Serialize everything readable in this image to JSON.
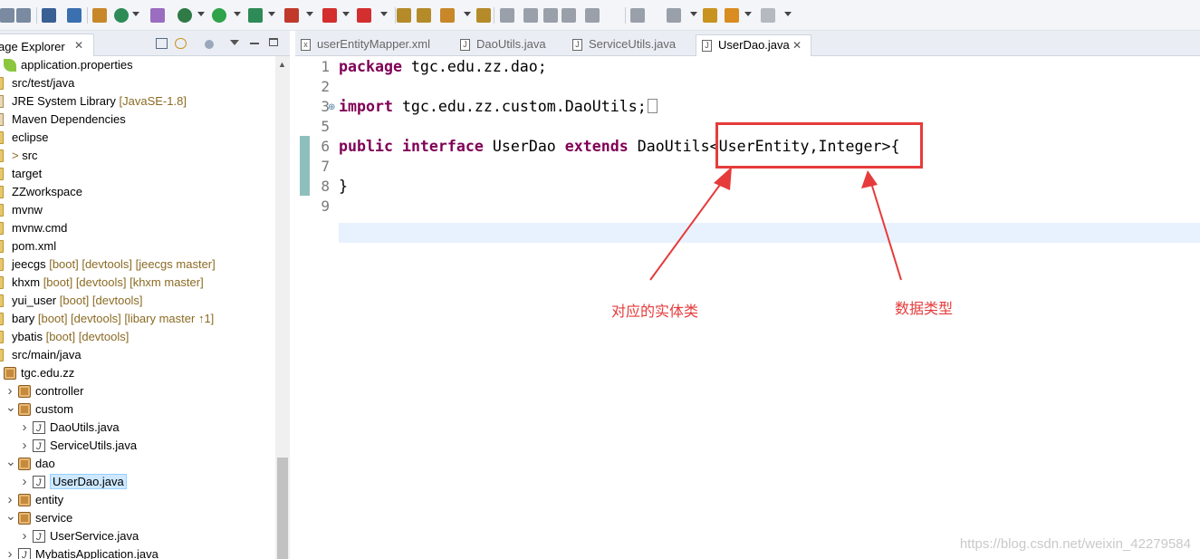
{
  "toolbar": {
    "icons": [
      "save-icon",
      "save-all-icon",
      "terminal-icon",
      "skip-breakpoints-icon",
      "build-icon",
      "refresh-icon",
      "search-replace-icon",
      "debug-icon",
      "run-icon",
      "coverage-icon",
      "external-tools-icon",
      "stop-icon",
      "new-server-icon",
      "new-java-project-icon",
      "open-folder-icon",
      "run-server-icon",
      "open-type-icon",
      "annotation-icon",
      "pin-editor-icon",
      "toggle-mark-icon",
      "block-select-icon",
      "show-whitespace-icon",
      "next-annotation-icon",
      "prev-annotation-icon",
      "last-edit-icon",
      "back-icon",
      "forward-icon"
    ]
  },
  "explorer": {
    "title": "age Explorer",
    "close_glyph": "✕",
    "rows": [
      {
        "label": "application.properties",
        "deco": "",
        "icon": "properties-icon"
      },
      {
        "label": "src/test/java",
        "deco": "",
        "icon": "source-folder-icon"
      },
      {
        "label": "JRE System Library",
        "deco": "[JavaSE-1.8]",
        "icon": "library-icon"
      },
      {
        "label": "Maven Dependencies",
        "deco": "",
        "icon": "library-icon"
      },
      {
        "label": "eclipse",
        "deco": "",
        "icon": "folder-icon"
      },
      {
        "label": "src",
        "deco": "",
        "icon": "folder-icon",
        "prefix": ">"
      },
      {
        "label": "target",
        "deco": "",
        "icon": "folder-icon"
      },
      {
        "label": "ZZworkspace",
        "deco": "",
        "icon": "folder-icon"
      },
      {
        "label": "mvnw",
        "deco": "",
        "icon": "file-icon"
      },
      {
        "label": "mvnw.cmd",
        "deco": "",
        "icon": "file-icon"
      },
      {
        "label": "pom.xml",
        "deco": "",
        "icon": "xml-file-icon"
      },
      {
        "label": "jeecgs",
        "deco": "[boot] [devtools] [jeecgs master]",
        "icon": "project-icon"
      },
      {
        "label": "khxm",
        "deco": "[boot] [devtools] [khxm master]",
        "icon": "project-icon"
      },
      {
        "label": "yui_user",
        "deco": "[boot] [devtools]",
        "icon": "project-icon"
      },
      {
        "label": "bary",
        "deco": "[boot] [devtools] [libary master ↑1]",
        "icon": "project-icon"
      },
      {
        "label": "ybatis",
        "deco": "[boot] [devtools]",
        "icon": "project-icon"
      },
      {
        "label": "src/main/java",
        "deco": "",
        "icon": "source-folder-icon"
      },
      {
        "label": "tgc.edu.zz",
        "deco": "",
        "icon": "package-icon"
      },
      {
        "label": "controller",
        "deco": "",
        "icon": "package-icon",
        "toggle": ">"
      },
      {
        "label": "custom",
        "deco": "",
        "icon": "package-icon",
        "toggle": "v"
      },
      {
        "label": "DaoUtils.java",
        "deco": "",
        "icon": "java-file-icon",
        "toggle": ">"
      },
      {
        "label": "ServiceUtils.java",
        "deco": "",
        "icon": "java-file-icon",
        "toggle": ">"
      },
      {
        "label": "dao",
        "deco": "",
        "icon": "package-icon",
        "toggle": "v"
      },
      {
        "label": "UserDao.java",
        "deco": "",
        "icon": "java-file-icon",
        "toggle": ">",
        "selected": true
      },
      {
        "label": "entity",
        "deco": "",
        "icon": "package-icon",
        "toggle": ">"
      },
      {
        "label": "service",
        "deco": "",
        "icon": "package-icon",
        "toggle": "v"
      },
      {
        "label": "UserService.java",
        "deco": "",
        "icon": "java-file-icon",
        "toggle": ">"
      },
      {
        "label": "MybatisApplication.java",
        "deco": "",
        "icon": "java-file-icon",
        "toggle": ">"
      }
    ]
  },
  "editor": {
    "tabs": [
      {
        "label": "userEntityMapper.xml",
        "icon": "xml-file-icon",
        "active": false
      },
      {
        "label": "DaoUtils.java",
        "icon": "java-file-icon",
        "active": false
      },
      {
        "label": "ServiceUtils.java",
        "icon": "java-file-icon",
        "active": false
      },
      {
        "label": "UserDao.java",
        "icon": "java-file-icon",
        "active": true
      }
    ],
    "line_numbers": [
      "1",
      "2",
      "3",
      "5",
      "6",
      "7",
      "8",
      "9"
    ],
    "lines": [
      {
        "kw": "package",
        "rest": " tgc.edu.zz.dao;"
      },
      {
        "kw": "",
        "rest": ""
      },
      {
        "kw": "import",
        "rest": " tgc.edu.zz.custom.DaoUtils;"
      },
      {
        "kw": "",
        "rest": ""
      },
      {
        "kw": "public",
        "kw2": "interface",
        "mid": " UserDao ",
        "kw3": "extends",
        "rest": " DaoUtils<UserEntity,Integer>{"
      },
      {
        "kw": "",
        "rest": ""
      },
      {
        "kw": "",
        "rest": "}"
      },
      {
        "kw": "",
        "rest": ""
      }
    ]
  },
  "annotations": {
    "entity_label": "对应的实体类",
    "type_label": "数据类型",
    "color": "#e63b3b"
  },
  "watermark": "https://blog.csdn.net/weixin_42279584"
}
